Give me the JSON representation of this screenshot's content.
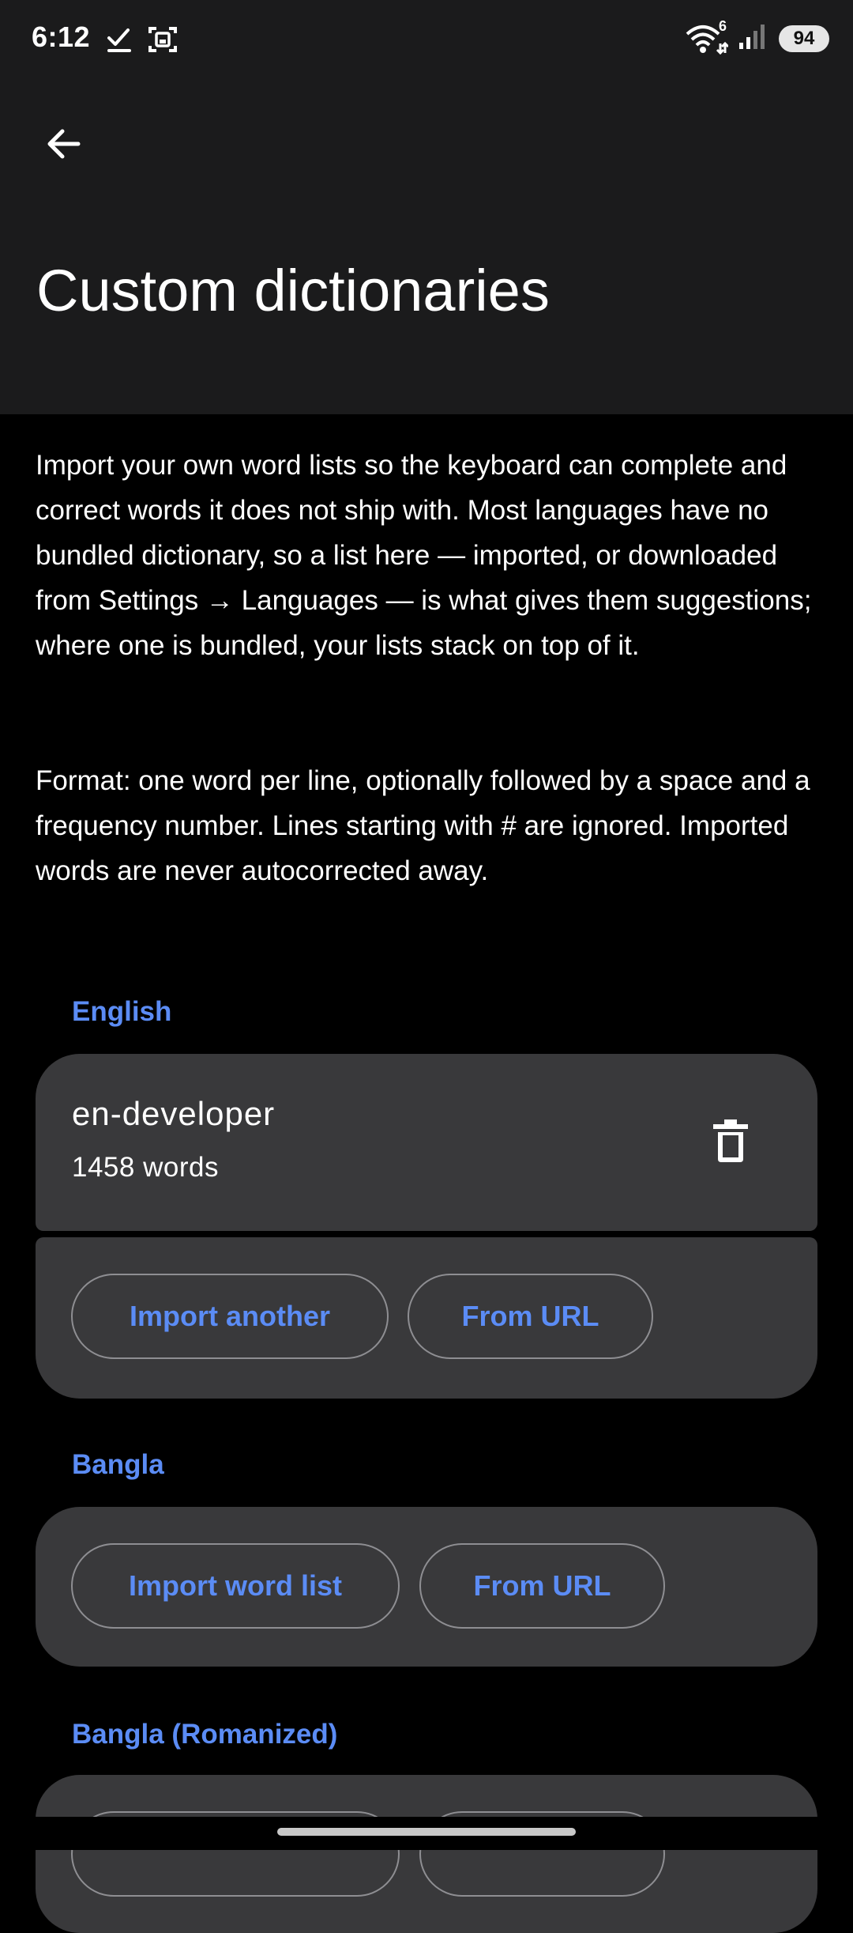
{
  "status_bar": {
    "time": "6:12",
    "wifi_badge": "6",
    "battery": "94"
  },
  "header": {
    "title": "Custom dictionaries"
  },
  "description": {
    "paragraph1": "Import your own word lists so the keyboard can complete and correct words it does not ship with. Most languages have no bundled dictionary, so a list here — imported, or downloaded from Settings → Languages — is what gives them suggestions; where one is bundled, your lists stack on top of it.",
    "paragraph2": "Format: one word per line, optionally followed by a space and a frequency number. Lines starting with # are ignored. Imported words are never autocorrected away."
  },
  "sections": [
    {
      "label": "English",
      "dictionary": {
        "name": "en-developer",
        "count": "1458 words"
      },
      "buttons": {
        "import": "Import another",
        "from_url": "From URL"
      }
    },
    {
      "label": "Bangla",
      "buttons": {
        "import": "Import word list",
        "from_url": "From URL"
      }
    },
    {
      "label": "Bangla (Romanized)"
    }
  ],
  "colors": {
    "accent": "#5b8cf5",
    "card": "#39393b",
    "topbar": "#1b1b1c",
    "background": "#000000"
  }
}
